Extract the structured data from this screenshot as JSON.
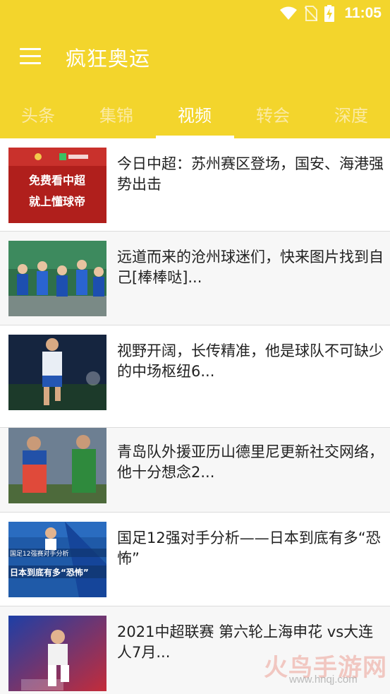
{
  "status_bar": {
    "time": "11:05"
  },
  "app_bar": {
    "title": "疯狂奥运"
  },
  "tabs": [
    {
      "label": "头条",
      "active": false
    },
    {
      "label": "集锦",
      "active": false
    },
    {
      "label": "视频",
      "active": true
    },
    {
      "label": "转会",
      "active": false
    },
    {
      "label": "深度",
      "active": false
    }
  ],
  "articles": [
    {
      "title": "今日中超：苏州赛区登场，国安、海港强势出击",
      "thumb_text": [
        "免费看中超",
        "就上懂球帝"
      ]
    },
    {
      "title": "远道而来的沧州球迷们，快来图片找到自己[棒棒哒]..."
    },
    {
      "title": "视野开阔，长传精准，他是球队不可缺少的中场枢纽6..."
    },
    {
      "title": "青岛队外援亚历山德里尼更新社交网络，他十分想念2..."
    },
    {
      "title": "国足12强对手分析——日本到底有多“恐怖”",
      "thumb_text": [
        "国足12强赛对手分析",
        "日本到底有多“恐怖”"
      ]
    },
    {
      "title": "2021中超联赛 第六轮上海申花 vs大连人7月..."
    }
  ],
  "watermark": {
    "main": "火鸟手游网",
    "sub": "www.hnqj.com"
  },
  "colors": {
    "accent": "#f3d52c",
    "tab_inactive": "#fbeaa3",
    "text": "#222222"
  }
}
